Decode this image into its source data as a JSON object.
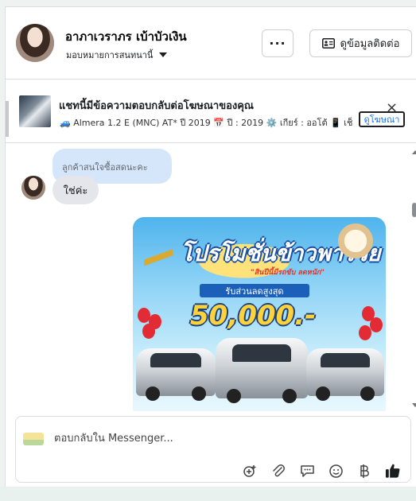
{
  "header": {
    "contact_name": "อาภาเวราภร เบ้าบัวเงิน",
    "assign_label": "มอบหมายการสนทนานี้",
    "more_label": "···",
    "contact_info_label": "ดูข้อมูลติดต่อ"
  },
  "ad": {
    "title": "แชทนี้มีข้อความตอบกลับต่อโฆษณาของคุณ",
    "detail": "🚙 Almera 1.2 E (MNC) AT* ปี 2019 📅 ปี : 2019 ⚙️ เกียร์ : ออโต้ 📱 เช็...",
    "view_ad_label": "ดูโฆษณา",
    "close_icon": "×"
  },
  "conversation": {
    "quoted_reply": "ลูกค้าสนใจซื้อสดนะคะ",
    "message_text": "ใช่ค่ะ",
    "promo_image": {
      "title": "โปรโมชั่นข้าวพารวย",
      "tagline": "\"สินปีนี้มีรถขับ ลดหนัก\"",
      "sub_label": "รับส่วนลดสูงสุด",
      "amount": "50,000.-"
    }
  },
  "composer": {
    "placeholder": "ตอบกลับใน Messenger...",
    "icons": [
      "add-person-icon",
      "attachment-icon",
      "saved-reply-icon",
      "emoji-icon",
      "baht-icon",
      "thumbs-up-icon"
    ]
  },
  "colors": {
    "accent": "#1876f2",
    "quoted_bubble": "#d5e6fb",
    "message_bubble": "#e4e6eb"
  }
}
